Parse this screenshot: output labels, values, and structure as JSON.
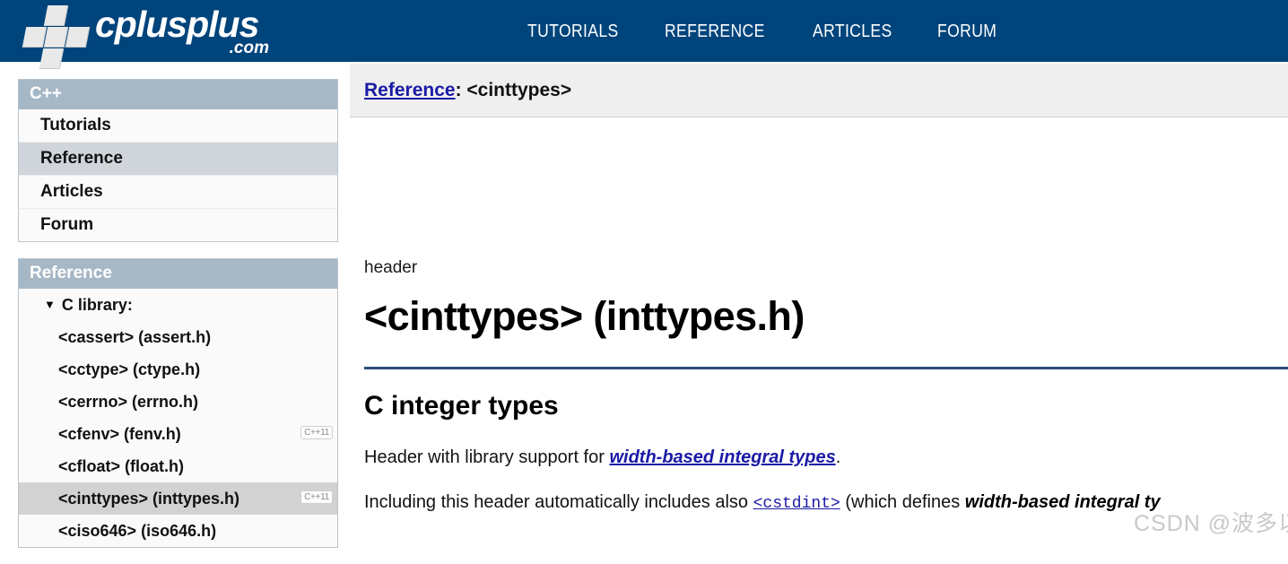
{
  "site": {
    "logo_main": "cplusplus",
    "logo_suffix": ".com",
    "logo_icon": "plus-cross-icon"
  },
  "topnav": {
    "items": [
      {
        "label": "TUTORIALS"
      },
      {
        "label": "REFERENCE"
      },
      {
        "label": "ARTICLES"
      },
      {
        "label": "FORUM"
      }
    ]
  },
  "sidebar": {
    "cpp_panel": {
      "title": "C++",
      "items": [
        {
          "label": "Tutorials",
          "selected": false
        },
        {
          "label": "Reference",
          "selected": true
        },
        {
          "label": "Articles",
          "selected": false
        },
        {
          "label": "Forum",
          "selected": false
        }
      ]
    },
    "reference_panel": {
      "title": "Reference",
      "tree": [
        {
          "label": "C library:",
          "caret": "▼",
          "root": true,
          "badge": "",
          "selected": false
        },
        {
          "label": "<cassert> (assert.h)",
          "badge": "",
          "selected": false
        },
        {
          "label": "<cctype> (ctype.h)",
          "badge": "",
          "selected": false
        },
        {
          "label": "<cerrno> (errno.h)",
          "badge": "",
          "selected": false
        },
        {
          "label": "<cfenv> (fenv.h)",
          "badge": "C++11",
          "selected": false
        },
        {
          "label": "<cfloat> (float.h)",
          "badge": "",
          "selected": false
        },
        {
          "label": "<cinttypes> (inttypes.h)",
          "badge": "C++11",
          "selected": true
        },
        {
          "label": "<ciso646> (iso646.h)",
          "badge": "",
          "selected": false
        }
      ]
    }
  },
  "breadcrumb": {
    "link": "Reference",
    "tail": " : <cinttypes>"
  },
  "article": {
    "kicker": "header",
    "title": "<cinttypes> (inttypes.h)",
    "subtitle": "C integer types",
    "p1_before": "Header with library support for ",
    "p1_link": "width-based integral types",
    "p1_after": ".",
    "p2_before": "Including this header automatically includes also ",
    "p2_link": "<cstdint>",
    "p2_mid": " (which defines ",
    "p2_em": "width-based integral ty"
  },
  "watermark": {
    "text": "CSDN @波多以雪利"
  },
  "colors": {
    "navy": "#00447c",
    "panel_head": "#a6b7c6",
    "selected_row": "#d2d2d2",
    "link_blue": "#1a1aa6",
    "rule": "#2b4a78"
  }
}
